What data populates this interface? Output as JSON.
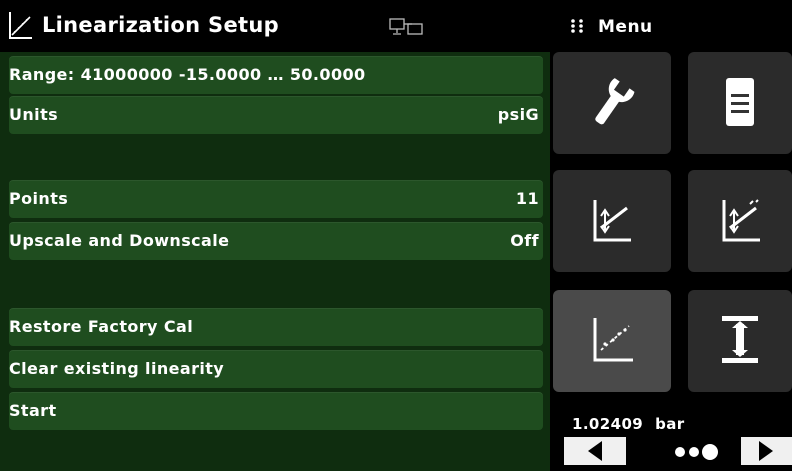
{
  "header": {
    "title": "Linearization Setup",
    "menu_label": "Menu",
    "icons": [
      "linearization-icon",
      "network-icon",
      "menu-grid-icon"
    ]
  },
  "settings": {
    "range": "Range: 41000000 -15.0000 … 50.0000",
    "units_label": "Units",
    "units_value": "psiG",
    "points_label": "Points",
    "points_value": "11",
    "updown_label": "Upscale and Downscale",
    "updown_value": "Off",
    "restore_label": "Restore Factory Cal",
    "clear_label": "Clear existing linearity",
    "start_label": "Start"
  },
  "tiles": [
    "wrench-icon",
    "document-icon",
    "linearization-icon",
    "linearization-edit-icon",
    "linearization-active-icon",
    "span-range-icon"
  ],
  "reading": {
    "value": "1.02409",
    "unit": "bar"
  },
  "colors": {
    "panel_bg": "#0f2d0f",
    "row_bg": "#1f4d1f",
    "tile_bg": "#2b2b2b",
    "tile_active_bg": "#4a4a4a"
  }
}
